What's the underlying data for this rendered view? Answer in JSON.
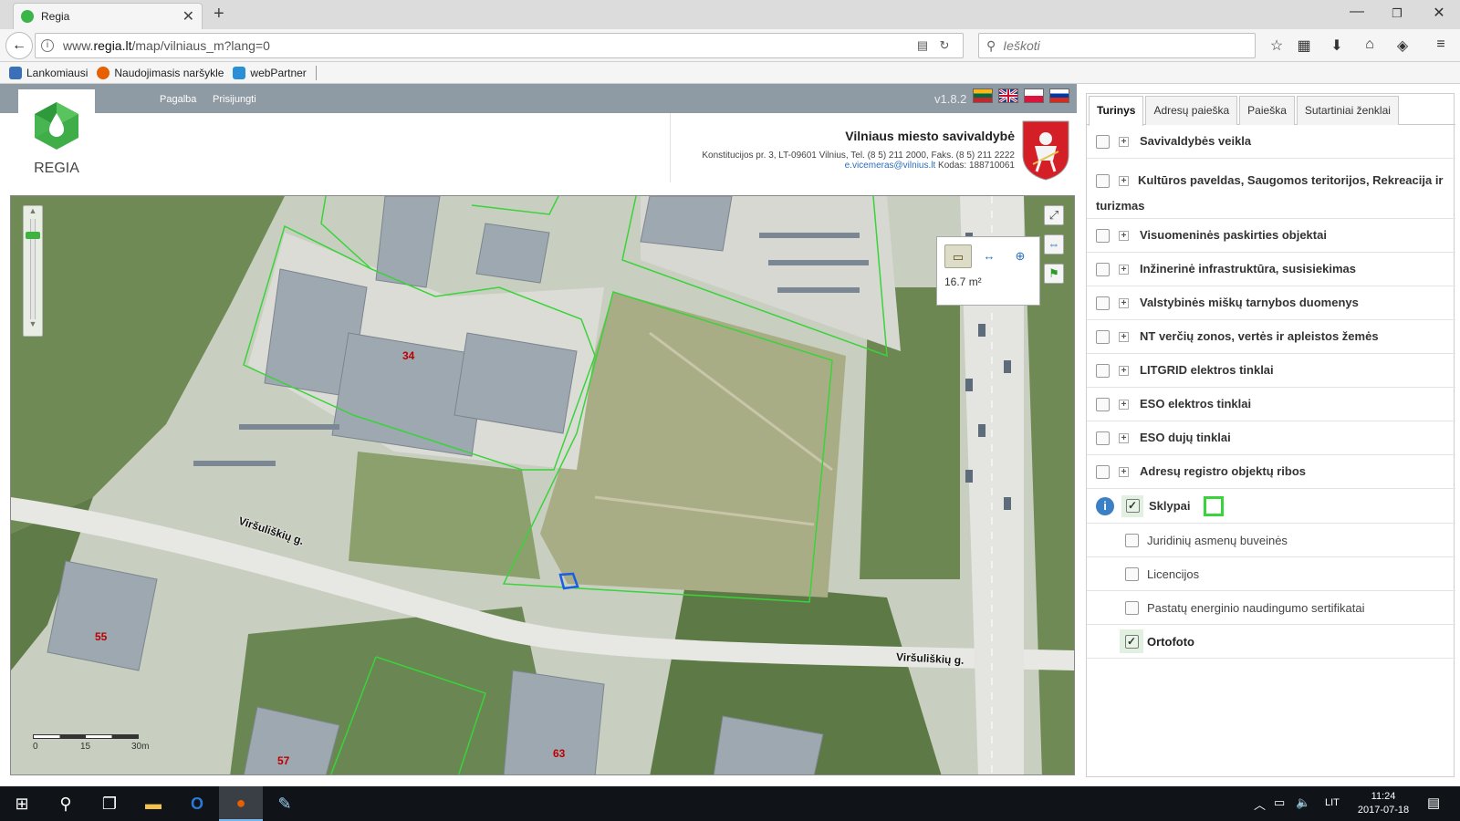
{
  "browser": {
    "tab_title": "Regia",
    "url_prefix": "www.",
    "url_host": "regia.lt",
    "url_path": "/map/vilniaus_m?lang=0",
    "search_placeholder": "Ieškoti",
    "bookmarks": [
      {
        "label": "Lankomiausi",
        "color": "#3b6fb6"
      },
      {
        "label": "Naudojimasis naršykle",
        "color": "#e66000"
      },
      {
        "label": "webPartner",
        "color": "#2b8fd6"
      }
    ]
  },
  "header": {
    "logo_text": "REGIA",
    "nav": [
      "Pagalba",
      "Prisijungti"
    ],
    "version": "v1.8.2",
    "org_title": "Vilniaus miesto savivaldybė",
    "org_address": "Konstitucijos pr. 3, LT-09601 Vilnius, Tel. (8 5) 211 2000, Faks. (8 5) 211 2222",
    "org_email": "e.vicemeras@vilnius.lt",
    "org_code": "Kodas: 188710061"
  },
  "map": {
    "streets": [
      "Viršuliškių g.",
      "Viršuliškių g."
    ],
    "parcel_numbers": [
      "34",
      "55",
      "63",
      "57"
    ],
    "measure_value": "16.7 m²",
    "scale_ticks": [
      "0",
      "15",
      "30m"
    ],
    "parcel_line_color": "#39d33a",
    "selection_color": "#1a5de6"
  },
  "panel": {
    "tabs": [
      "Turinys",
      "Adresų paieška",
      "Paieška",
      "Sutartiniai ženklai"
    ],
    "layers": [
      "Savivaldybės veikla",
      "Kultūros paveldas, Saugomos teritorijos, Rekreacija ir turizmas",
      "Visuomeninės paskirties objektai",
      "Inžinerinė infrastruktūra, susisiekimas",
      "Valstybinės miškų tarnybos duomenys",
      "NT verčių zonos, vertės ir apleistos žemės",
      "LITGRID elektros tinklai",
      "ESO elektros tinklai",
      "ESO dujų tinklai",
      "Adresų registro objektų ribos"
    ],
    "active_layer": "Sklypai",
    "sublayers": [
      {
        "label": "Juridinių asmenų buveinės",
        "checked": false
      },
      {
        "label": "Licencijos",
        "checked": false
      },
      {
        "label": "Pastatų energinio naudingumo sertifikatai",
        "checked": false
      },
      {
        "label": "Ortofoto",
        "checked": true
      }
    ]
  },
  "taskbar": {
    "lang": "LIT",
    "time": "11:24",
    "date": "2017-07-18"
  }
}
